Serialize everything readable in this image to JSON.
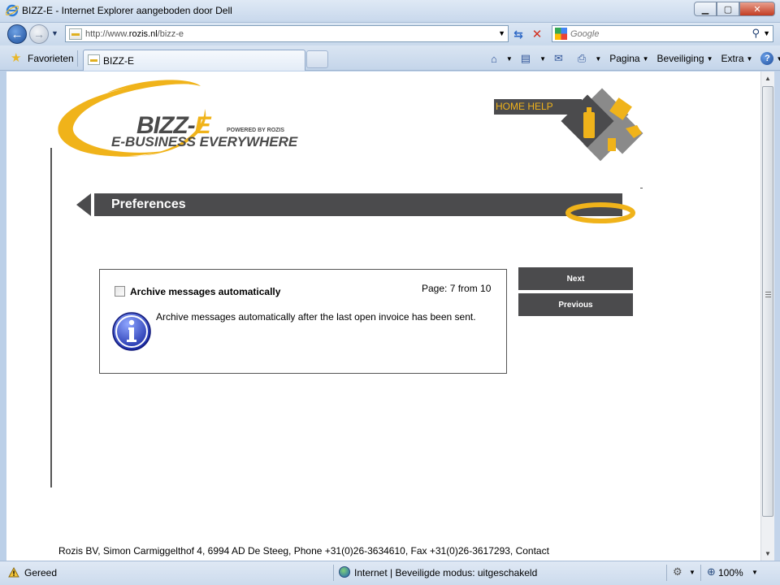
{
  "window": {
    "title": "BIZZ-E - Internet Explorer aangeboden door Dell",
    "minimize": "▁",
    "maximize": "▢",
    "close": "✕"
  },
  "address": {
    "url_prefix": "http://www.",
    "url_domain": "rozis.nl",
    "url_path": "/bizz-e"
  },
  "search": {
    "placeholder": "Google"
  },
  "tabs": {
    "favorites_label": "Favorieten",
    "active_tab_label": "BIZZ-E"
  },
  "commandbar": {
    "page_label": "Pagina",
    "safety_label": "Beveiliging",
    "extra_label": "Extra"
  },
  "page": {
    "logo": {
      "name_main": "BIZZ-",
      "name_accent": "E",
      "tagline": "E-BUSINESS EVERYWHERE",
      "powered": "POWERED BY ROZIS"
    },
    "home_help": "HOME HELP",
    "section_title": "Preferences",
    "checkbox_label": "Archive messages automatically",
    "checkbox_checked": false,
    "page_indicator": "Page: 7 from 10",
    "info_text": "Archive messages automatically after the last open invoice has been sent.",
    "next_label": "Next",
    "previous_label": "Previous",
    "footer": "Rozis BV, Simon Carmiggelthof 4, 6994 AD De Steeg, Phone +31(0)26-3634610, Fax +31(0)26-3617293, Contact"
  },
  "statusbar": {
    "status": "Gereed",
    "zone": "Internet | Beveiligde modus: uitgeschakeld",
    "zoom": "100%"
  },
  "colors": {
    "brand_yellow": "#f0b31a",
    "brand_dark": "#4b4b4d",
    "info_blue": "#2a3db0"
  }
}
